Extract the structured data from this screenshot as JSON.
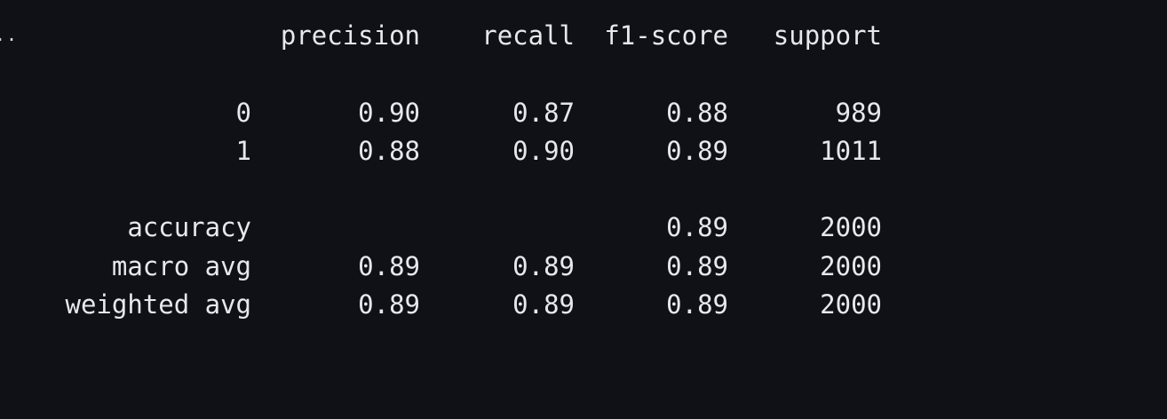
{
  "output": {
    "ellipsis": "..",
    "headers": {
      "precision": "precision",
      "recall": "recall",
      "f1": "f1-score",
      "support": "support"
    },
    "rows": [
      {
        "label": "0",
        "precision": "0.90",
        "recall": "0.87",
        "f1": "0.88",
        "support": "989"
      },
      {
        "label": "1",
        "precision": "0.88",
        "recall": "0.90",
        "f1": "0.89",
        "support": "1011"
      }
    ],
    "summary": [
      {
        "label": "accuracy",
        "precision": "",
        "recall": "",
        "f1": "0.89",
        "support": "2000"
      },
      {
        "label": "macro avg",
        "precision": "0.89",
        "recall": "0.89",
        "f1": "0.89",
        "support": "2000"
      },
      {
        "label": "weighted avg",
        "precision": "0.89",
        "recall": "0.89",
        "f1": "0.89",
        "support": "2000"
      }
    ]
  }
}
